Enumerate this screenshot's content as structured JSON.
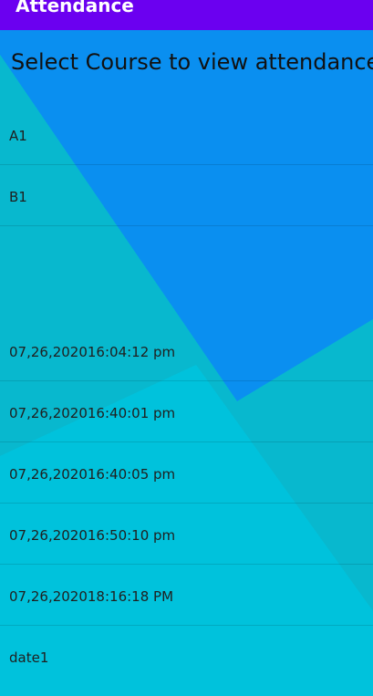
{
  "app_bar": {
    "title": "Attendance",
    "color": "#6b00f0"
  },
  "heading": "Select Course to view attendance",
  "courses": [
    {
      "label": "A1"
    },
    {
      "label": "B1"
    }
  ],
  "dates": [
    {
      "label": "07,26,202016:04:12 pm"
    },
    {
      "label": "07,26,202016:40:01 pm"
    },
    {
      "label": "07,26,202016:40:05 pm"
    },
    {
      "label": "07,26,202016:50:10 pm"
    },
    {
      "label": "07,26,202018:16:18 PM"
    },
    {
      "label": "date1"
    }
  ],
  "colors": {
    "background": "#00c2dc",
    "blue_panel": "#0a8ff0",
    "teal_panel": "#08b7cc"
  }
}
